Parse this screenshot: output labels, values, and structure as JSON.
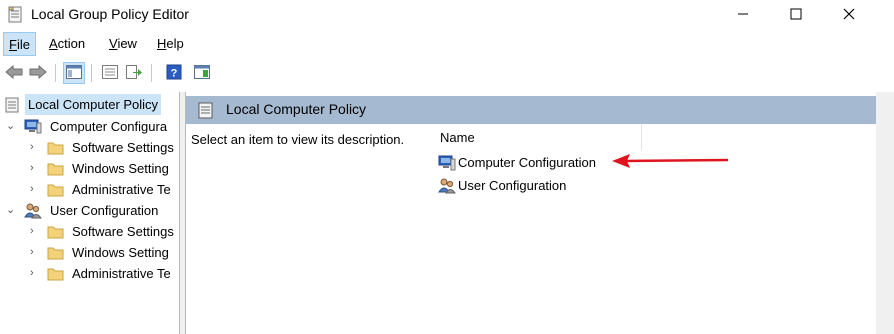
{
  "window": {
    "title": "Local Group Policy Editor"
  },
  "menu": {
    "items": [
      {
        "label": "File",
        "underline": "F",
        "rest": "ile",
        "active": true
      },
      {
        "label": "Action",
        "underline": "A",
        "rest": "ction",
        "active": false
      },
      {
        "label": "View",
        "underline": "V",
        "rest": "iew",
        "active": false
      },
      {
        "label": "Help",
        "underline": "H",
        "rest": "elp",
        "active": false
      }
    ]
  },
  "tree": {
    "root": "Local Computer Policy",
    "computer": "Computer Configura",
    "computer_children": [
      "Software Settings",
      "Windows Setting",
      "Administrative Te"
    ],
    "user": "User Configuration",
    "user_children": [
      "Software Settings",
      "Windows Setting",
      "Administrative Te"
    ]
  },
  "main": {
    "header_title": "Local Computer Policy",
    "description": "Select an item to view its description.",
    "column_name": "Name",
    "items": [
      "Computer Configuration",
      "User Configuration"
    ]
  },
  "colors": {
    "header_bar": "#a5b9d0",
    "selection": "#cce4f7",
    "annotation_arrow": "#e0141e"
  }
}
